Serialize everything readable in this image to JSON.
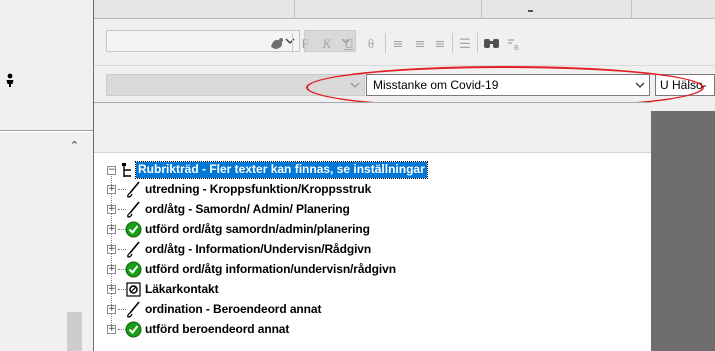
{
  "toolbar": {
    "buttons": [
      {
        "name": "template-icon",
        "glyph": "♧"
      },
      {
        "name": "bold-icon",
        "glyph": "F"
      },
      {
        "name": "italic-icon",
        "glyph": "K"
      },
      {
        "name": "underline-icon",
        "glyph": "U"
      },
      {
        "name": "strikethrough-icon",
        "glyph": "θ"
      },
      {
        "name": "align-left-icon",
        "glyph": "≡"
      },
      {
        "name": "align-center-icon",
        "glyph": "≡"
      },
      {
        "name": "align-right-icon",
        "glyph": "≡"
      },
      {
        "name": "bullet-list-icon",
        "glyph": "☰"
      },
      {
        "name": "find-icon",
        "glyph": "☉"
      }
    ]
  },
  "selectors": {
    "term": "Misstanke om Covid-19",
    "next_value": "U Hälso-"
  },
  "tree": {
    "root_label": "Rubrikträd - Fler texter kan finnas, se inställningar",
    "items": [
      {
        "label": "utredning - Kroppsfunktion/Kroppsstruk",
        "icon": "pen"
      },
      {
        "label": "ord/åtg - Samordn/ Admin/ Planering",
        "icon": "pen"
      },
      {
        "label": "utförd ord/åtg samordn/admin/planering",
        "icon": "check"
      },
      {
        "label": "ord/åtg - Information/Undervisn/Rådgivn",
        "icon": "pen"
      },
      {
        "label": "utförd ord/åtg information/undervisn/rådgivn",
        "icon": "check"
      },
      {
        "label": "Läkarkontakt",
        "icon": "box"
      },
      {
        "label": "ordination - Beroendeord annat",
        "icon": "pen"
      },
      {
        "label": "utförd beroendeord annat",
        "icon": "check"
      }
    ]
  },
  "colors": {
    "selection": "#0078d7",
    "annotation": "#e31e24",
    "check_green": "#1a9e1a"
  }
}
